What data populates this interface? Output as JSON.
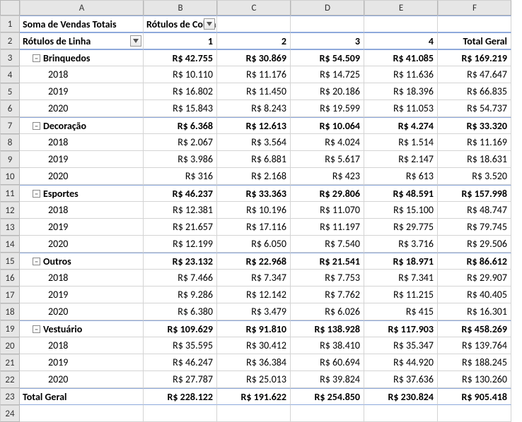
{
  "columns": [
    "A",
    "B",
    "C",
    "D",
    "E",
    "F"
  ],
  "pivot": {
    "title": "Soma de Vendas Totais",
    "col_label": "Rótulos de Coluna",
    "row_label": "Rótulos de Linha",
    "col_headers": [
      "1",
      "2",
      "3",
      "4"
    ],
    "grand_col": "Total Geral",
    "grand_row": "Total Geral",
    "categories": [
      {
        "name": "Brinquedos",
        "totals": [
          "R$ 42.755",
          "R$ 30.869",
          "R$ 54.509",
          "R$ 41.085",
          "R$ 169.219"
        ],
        "years": [
          {
            "y": "2018",
            "v": [
              "R$ 10.110",
              "R$ 11.176",
              "R$ 14.725",
              "R$ 11.636",
              "R$ 47.647"
            ]
          },
          {
            "y": "2019",
            "v": [
              "R$ 16.802",
              "R$ 11.450",
              "R$ 20.186",
              "R$ 18.396",
              "R$ 66.835"
            ]
          },
          {
            "y": "2020",
            "v": [
              "R$ 15.843",
              "R$ 8.243",
              "R$ 19.599",
              "R$ 11.053",
              "R$ 54.737"
            ]
          }
        ]
      },
      {
        "name": "Decoração",
        "totals": [
          "R$ 6.368",
          "R$ 12.613",
          "R$ 10.064",
          "R$ 4.274",
          "R$ 33.320"
        ],
        "years": [
          {
            "y": "2018",
            "v": [
              "R$ 2.067",
              "R$ 3.564",
              "R$ 4.024",
              "R$ 1.514",
              "R$ 11.169"
            ]
          },
          {
            "y": "2019",
            "v": [
              "R$ 3.986",
              "R$ 6.881",
              "R$ 5.617",
              "R$ 2.147",
              "R$ 18.631"
            ]
          },
          {
            "y": "2020",
            "v": [
              "R$ 316",
              "R$ 2.168",
              "R$ 423",
              "R$ 613",
              "R$ 3.520"
            ]
          }
        ]
      },
      {
        "name": "Esportes",
        "totals": [
          "R$ 46.237",
          "R$ 33.363",
          "R$ 29.806",
          "R$ 48.591",
          "R$ 157.998"
        ],
        "years": [
          {
            "y": "2018",
            "v": [
              "R$ 12.381",
              "R$ 10.196",
              "R$ 11.070",
              "R$ 15.100",
              "R$ 48.747"
            ]
          },
          {
            "y": "2019",
            "v": [
              "R$ 21.657",
              "R$ 17.116",
              "R$ 11.197",
              "R$ 29.775",
              "R$ 79.745"
            ]
          },
          {
            "y": "2020",
            "v": [
              "R$ 12.199",
              "R$ 6.050",
              "R$ 7.540",
              "R$ 3.716",
              "R$ 29.506"
            ]
          }
        ]
      },
      {
        "name": "Outros",
        "totals": [
          "R$ 23.132",
          "R$ 22.968",
          "R$ 21.541",
          "R$ 18.971",
          "R$ 86.612"
        ],
        "years": [
          {
            "y": "2018",
            "v": [
              "R$ 7.466",
              "R$ 7.347",
              "R$ 7.753",
              "R$ 7.341",
              "R$ 29.907"
            ]
          },
          {
            "y": "2019",
            "v": [
              "R$ 9.286",
              "R$ 12.142",
              "R$ 7.762",
              "R$ 11.215",
              "R$ 40.405"
            ]
          },
          {
            "y": "2020",
            "v": [
              "R$ 6.380",
              "R$ 3.479",
              "R$ 6.026",
              "R$ 415",
              "R$ 16.301"
            ]
          }
        ]
      },
      {
        "name": "Vestuário",
        "totals": [
          "R$ 109.629",
          "R$ 91.810",
          "R$ 138.928",
          "R$ 117.903",
          "R$ 458.269"
        ],
        "years": [
          {
            "y": "2018",
            "v": [
              "R$ 35.595",
              "R$ 30.412",
              "R$ 38.410",
              "R$ 35.347",
              "R$ 139.764"
            ]
          },
          {
            "y": "2019",
            "v": [
              "R$ 46.247",
              "R$ 36.384",
              "R$ 60.694",
              "R$ 44.920",
              "R$ 188.245"
            ]
          },
          {
            "y": "2020",
            "v": [
              "R$ 27.787",
              "R$ 25.013",
              "R$ 39.824",
              "R$ 37.636",
              "R$ 130.260"
            ]
          }
        ]
      }
    ],
    "grand_totals": [
      "R$ 228.122",
      "R$ 191.622",
      "R$ 254.850",
      "R$ 230.824",
      "R$ 905.418"
    ]
  }
}
